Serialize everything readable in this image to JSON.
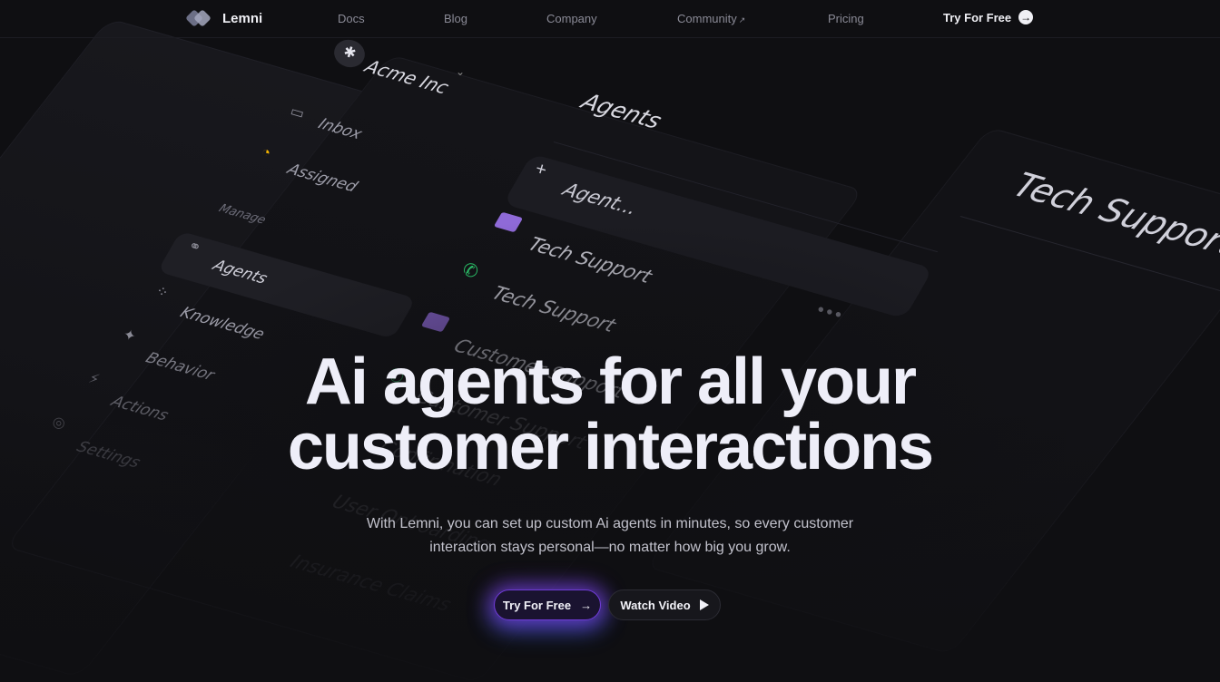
{
  "nav": {
    "brand": "Lemni",
    "links": [
      "Docs",
      "Blog",
      "Company",
      "Community",
      "Pricing"
    ],
    "community_arrow": "↗",
    "cta": "Try For Free"
  },
  "mockup": {
    "workspace": "Acme Inc",
    "sidebar": {
      "inbox": "Inbox",
      "assigned": "Assigned",
      "manage_heading": "Manage",
      "agents": "Agents",
      "knowledge": "Knowledge",
      "behavior": "Behavior",
      "actions": "Actions",
      "settings": "Settings"
    },
    "agents_panel": {
      "title": "Agents",
      "new_agent": "Agent...",
      "rows": [
        "Tech Support",
        "Tech Support",
        "Customer Support",
        "Customer Support",
        "Confirmation",
        "User Onboarding",
        "Insurance Claims"
      ]
    },
    "detail_title": "Tech Support"
  },
  "hero": {
    "title_line1": "Ai agents for all your",
    "title_line2": "customer interactions",
    "subtitle": "With Lemni, you can set up custom Ai agents in minutes, so every customer interaction stays personal—no matter how big you grow.",
    "primary_cta": "Try For Free",
    "secondary_cta": "Watch Video"
  },
  "colors": {
    "background": "#0f0f12",
    "accent_purple": "#9d40ff",
    "accent_blue": "#286eff",
    "agent_green": "#2ed573",
    "agent_violet": "#8f6ad8"
  }
}
